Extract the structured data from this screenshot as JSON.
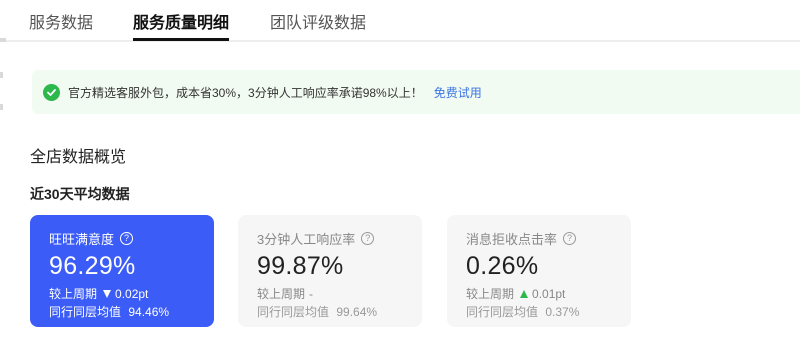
{
  "tabs": [
    {
      "label": "服务数据"
    },
    {
      "label": "服务质量明细",
      "active": true
    },
    {
      "label": "团队评级数据"
    }
  ],
  "notice": {
    "text": "官方精选客服外包，成本省30%，3分钟人工响应率承诺98%以上！",
    "link": "免费试用"
  },
  "section_title": "全店数据概览",
  "sub_title": "近30天平均数据",
  "cards": [
    {
      "label": "旺旺满意度",
      "value": "96.29%",
      "compare_label": "较上周期",
      "compare_direction": "down",
      "compare_value": "0.02pt",
      "peer_label": "同行同层均值",
      "peer_value": "94.46%",
      "selected": true
    },
    {
      "label": "3分钟人工响应率",
      "value": "99.87%",
      "compare_label": "较上周期",
      "compare_direction": "none",
      "compare_value": "-",
      "peer_label": "同行同层均值",
      "peer_value": "99.64%"
    },
    {
      "label": "消息拒收点击率",
      "value": "0.26%",
      "compare_label": "较上周期",
      "compare_direction": "up",
      "compare_value": "0.01pt",
      "peer_label": "同行同层均值",
      "peer_value": "0.37%"
    }
  ],
  "colors": {
    "accent": "#3b5cf6",
    "success": "#2db84d",
    "link": "#3b74e6",
    "notice_bg": "#f2fbf1"
  }
}
